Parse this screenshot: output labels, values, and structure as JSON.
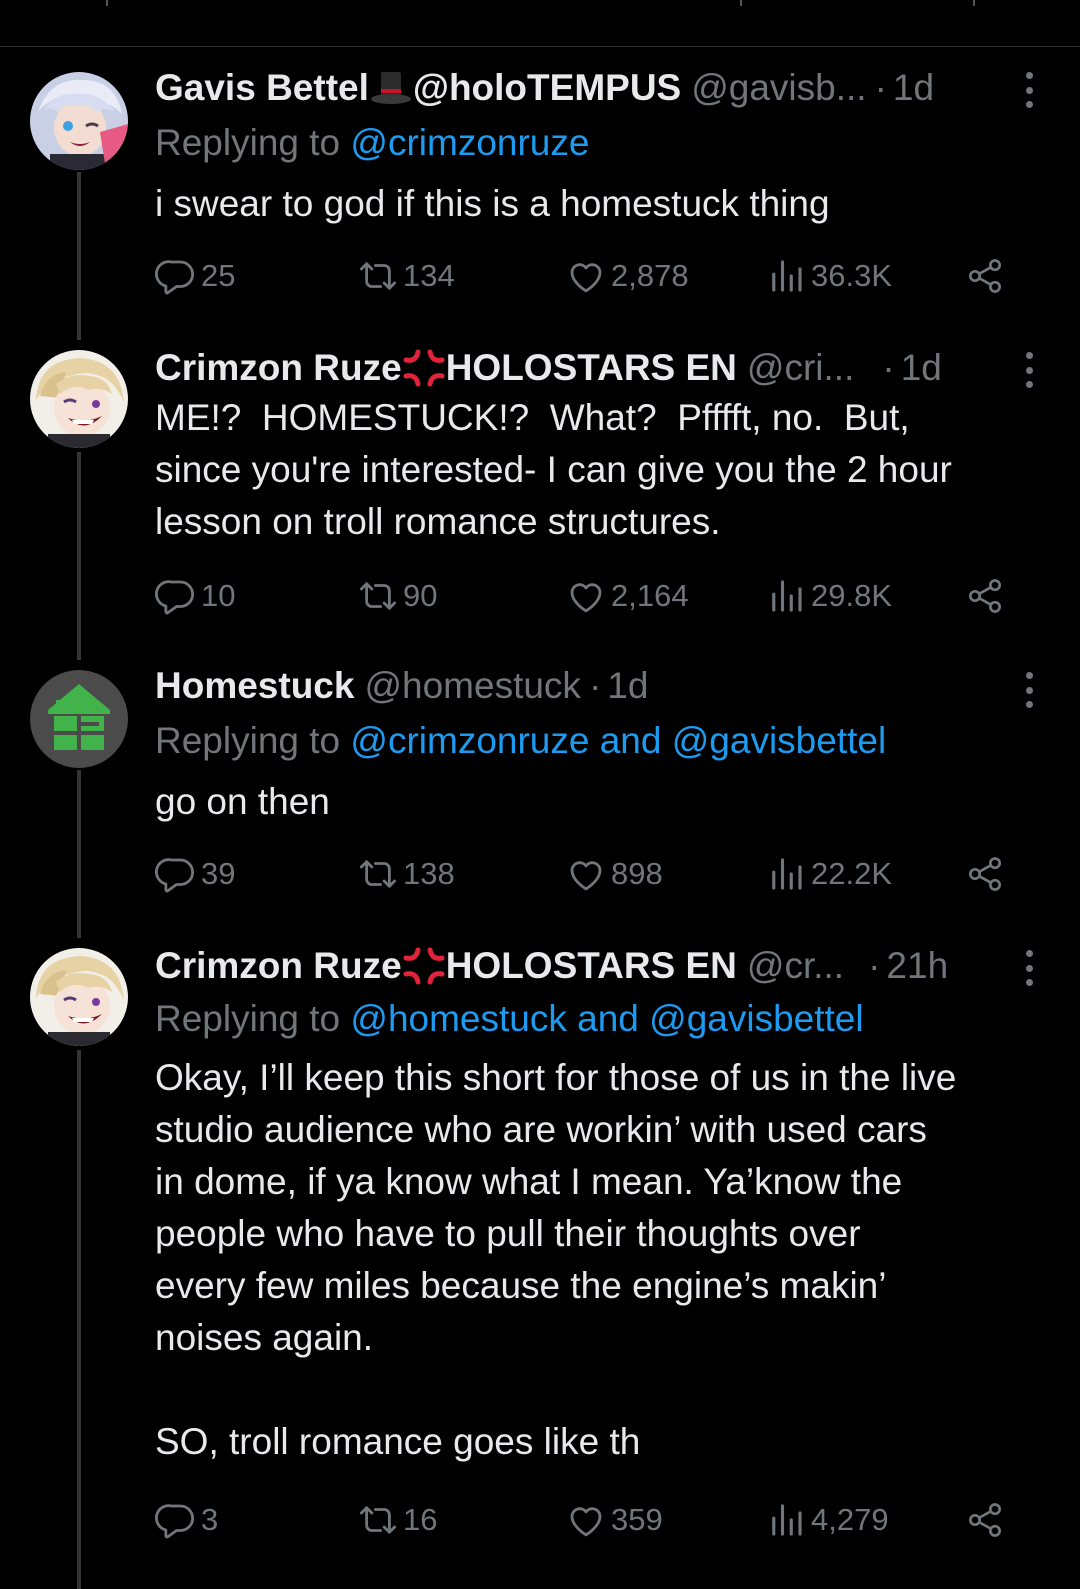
{
  "colors": {
    "background": "#000000",
    "text": "#e7e9ea",
    "muted": "#71767b",
    "link": "#1d9bf0",
    "thread_line": "#333639"
  },
  "icons": {
    "reply": "reply-icon",
    "repost": "repost-icon",
    "like": "heart-icon",
    "views": "views-icon",
    "share": "share-icon",
    "more": "more-options-icon"
  },
  "tweets": [
    {
      "display_name": "Gavis Bettel",
      "name_suffix": "@holoTEMPUS",
      "handle": "@gavisb...",
      "dot": "·",
      "time": "1d",
      "reply_prefix": "Replying to ",
      "reply_mentions": "@crimzonruze",
      "text": "i swear to god if this is a homestuck thing",
      "replies": "25",
      "reposts": "134",
      "likes": "2,878",
      "views": "36.3K"
    },
    {
      "display_name": "Crimzon Ruze",
      "name_suffix": "HOLOSTARS EN",
      "handle": "@cri...",
      "dot": "·",
      "time": "1d",
      "text": "ME!?  HOMESTUCK!?  What?  Pfffft, no.  But,\nsince you're interested- I can give you the 2 hour\nlesson on troll romance structures.",
      "replies": "10",
      "reposts": "90",
      "likes": "2,164",
      "views": "29.8K"
    },
    {
      "display_name": "Homestuck",
      "handle": "@homestuck",
      "dot": "·",
      "time": "1d",
      "reply_prefix": "Replying to ",
      "reply_mentions": "@crimzonruze and @gavisbettel",
      "text": "go on then",
      "replies": "39",
      "reposts": "138",
      "likes": "898",
      "views": "22.2K"
    },
    {
      "display_name": "Crimzon Ruze",
      "name_suffix": "HOLOSTARS EN",
      "handle": "@cr...",
      "dot": "·",
      "time": "21h",
      "reply_prefix": "Replying to ",
      "reply_mentions": "@homestuck and @gavisbettel",
      "text": "Okay, I’ll keep this short for those of us in the live\nstudio audience who are workin’ with used cars\nin dome, if ya know what I mean. Ya’know the\npeople who have to pull their thoughts over\nevery few miles because the engine’s makin’\nnoises again.\n\nSO, troll romance goes like th",
      "replies": "3",
      "reposts": "16",
      "likes": "359",
      "views": "4,279"
    }
  ]
}
